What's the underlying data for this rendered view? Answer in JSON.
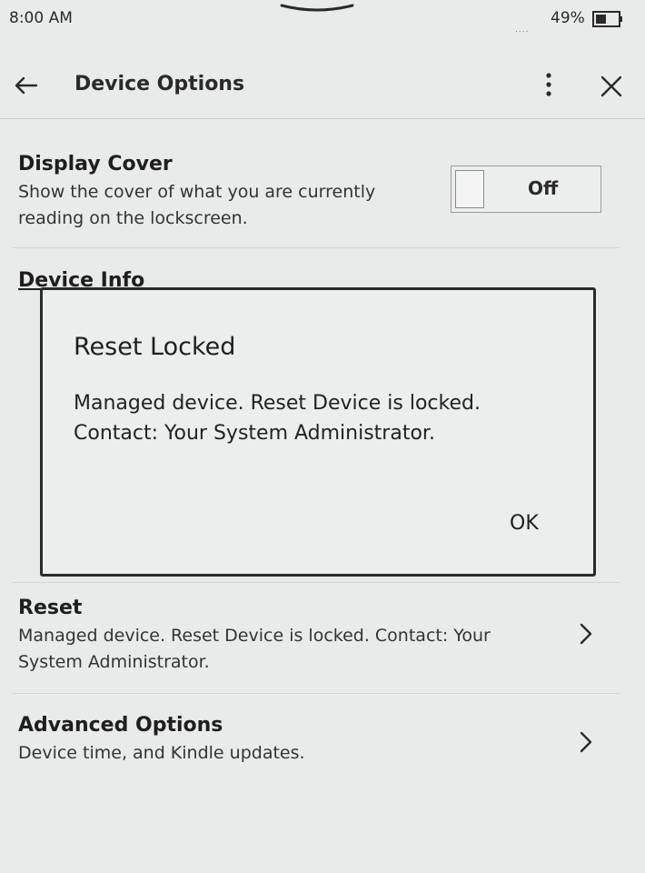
{
  "status": {
    "time": "8:00 AM",
    "battery": "49%"
  },
  "header": {
    "title": "Device Options"
  },
  "display_cover": {
    "title": "Display Cover",
    "description": "Show the cover of what you are currently reading on the lockscreen.",
    "toggle_state": "Off"
  },
  "device_info": {
    "title": "Device Info"
  },
  "reset": {
    "title": "Reset",
    "description": "Managed device. Reset Device is locked. Contact: Your System Administrator."
  },
  "advanced": {
    "title": "Advanced Options",
    "description": "Device time, and Kindle updates."
  },
  "dialog": {
    "title": "Reset Locked",
    "line1": "Managed device. Reset Device is locked.",
    "line2": "Contact: Your System Administrator.",
    "ok_label": "OK"
  },
  "icons": {
    "back": "arrow-left-icon",
    "menu": "kebab-menu-icon",
    "close": "close-icon",
    "chevron": "chevron-right-icon",
    "battery": "battery-icon"
  }
}
